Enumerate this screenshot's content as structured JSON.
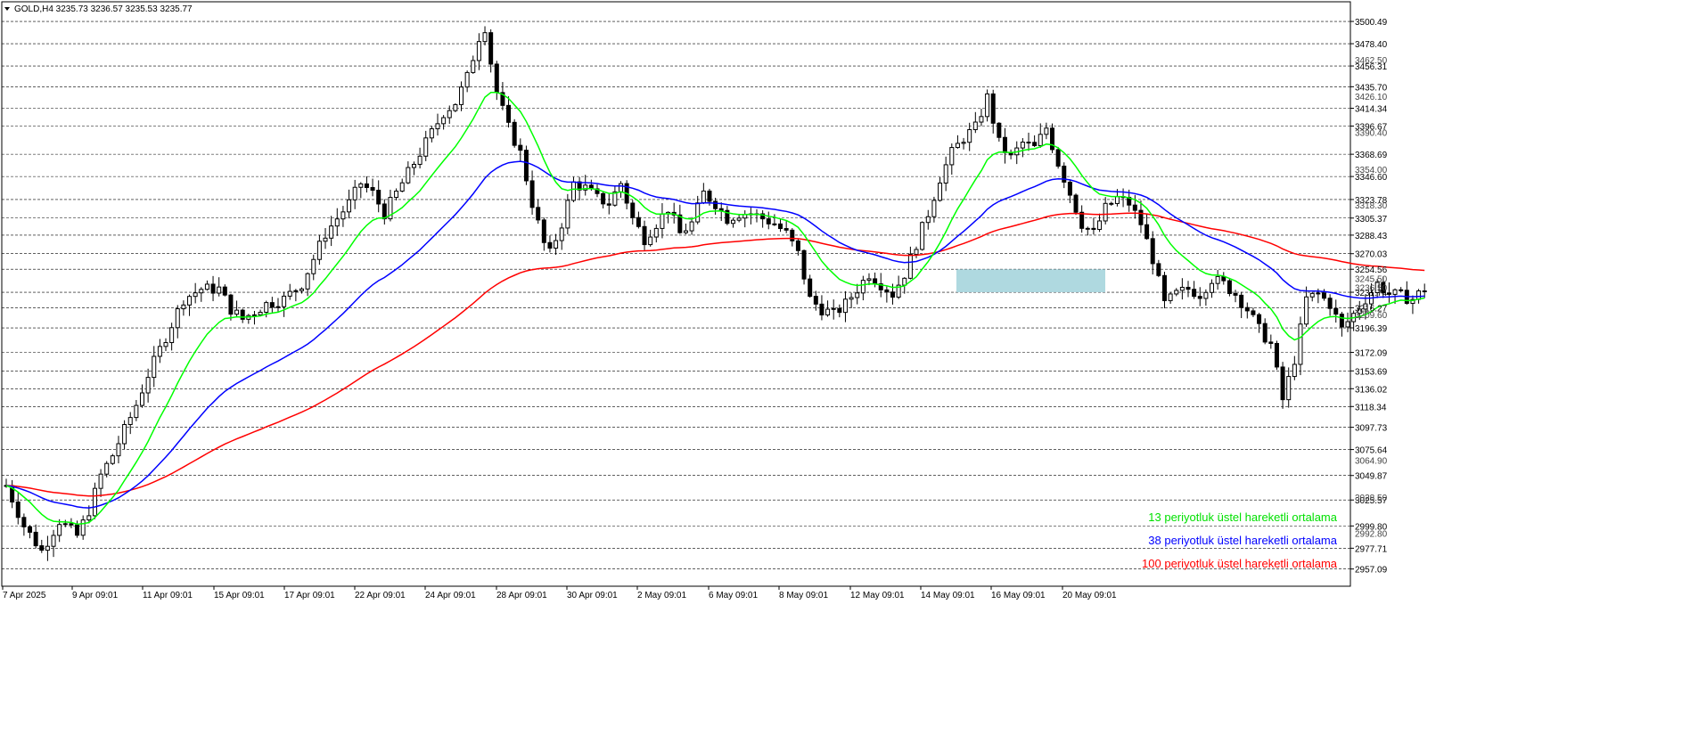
{
  "header": {
    "symbol_text": "GOLD,H4  3235.73 3236.57 3235.53 3235.77",
    "menu_icon": "triangle-down-icon"
  },
  "chart_data": {
    "type": "candlestick",
    "symbol": "GOLD",
    "timeframe": "H4",
    "last_ohlc": {
      "open": 3235.73,
      "high": 3236.57,
      "low": 3235.53,
      "close": 3235.77
    },
    "ylim": [
      2940,
      3520
    ],
    "y_levels": [
      3500.49,
      3478.4,
      3456.31,
      3435.7,
      3414.34,
      3396.67,
      3368.69,
      3346.6,
      3323.78,
      3305.37,
      3288.43,
      3270.03,
      3254.56,
      3231.74,
      3216.27,
      3196.39,
      3172.09,
      3153.69,
      3136.02,
      3118.34,
      3097.73,
      3075.64,
      3049.87,
      3025.57,
      2999.8,
      2977.71,
      2957.09
    ],
    "minor_levels": [
      3462.5,
      3426.1,
      3390.4,
      3354.0,
      3318.3,
      3245.5,
      3236.5,
      3209.6,
      3064.9,
      3028.5,
      2992.8
    ],
    "x_labels": [
      "7 Apr 2025",
      "9 Apr 09:01",
      "11 Apr 09:01",
      "15 Apr 09:01",
      "17 Apr 09:01",
      "22 Apr 09:01",
      "24 Apr 09:01",
      "28 Apr 09:01",
      "30 Apr 09:01",
      "2 May 09:01",
      "6 May 09:01",
      "8 May 09:01",
      "12 May 09:01",
      "14 May 09:01",
      "16 May 09:01",
      "20 May 09:01"
    ],
    "bars_per_label": 12,
    "anchors": [
      [
        0,
        3040
      ],
      [
        3,
        3000
      ],
      [
        6,
        2975
      ],
      [
        9,
        3005
      ],
      [
        12,
        2990
      ],
      [
        14,
        3015
      ],
      [
        16,
        3050
      ],
      [
        18,
        3070
      ],
      [
        20,
        3095
      ],
      [
        22,
        3120
      ],
      [
        24,
        3150
      ],
      [
        26,
        3175
      ],
      [
        28,
        3200
      ],
      [
        30,
        3225
      ],
      [
        33,
        3235
      ],
      [
        36,
        3235
      ],
      [
        38,
        3215
      ],
      [
        40,
        3205
      ],
      [
        44,
        3220
      ],
      [
        47,
        3225
      ],
      [
        50,
        3240
      ],
      [
        52,
        3265
      ],
      [
        54,
        3290
      ],
      [
        56,
        3305
      ],
      [
        58,
        3320
      ],
      [
        60,
        3340
      ],
      [
        62,
        3330
      ],
      [
        64,
        3310
      ],
      [
        66,
        3330
      ],
      [
        68,
        3350
      ],
      [
        70,
        3370
      ],
      [
        72,
        3390
      ],
      [
        74,
        3410
      ],
      [
        76,
        3420
      ],
      [
        78,
        3445
      ],
      [
        80,
        3485
      ],
      [
        81,
        3495
      ],
      [
        82,
        3460
      ],
      [
        83,
        3430
      ],
      [
        85,
        3395
      ],
      [
        87,
        3370
      ],
      [
        89,
        3320
      ],
      [
        91,
        3280
      ],
      [
        92,
        3270
      ],
      [
        94,
        3300
      ],
      [
        96,
        3340
      ],
      [
        98,
        3335
      ],
      [
        100,
        3325
      ],
      [
        102,
        3320
      ],
      [
        104,
        3340
      ],
      [
        106,
        3305
      ],
      [
        108,
        3285
      ],
      [
        110,
        3300
      ],
      [
        112,
        3315
      ],
      [
        114,
        3290
      ],
      [
        116,
        3300
      ],
      [
        118,
        3330
      ],
      [
        120,
        3320
      ],
      [
        122,
        3305
      ],
      [
        124,
        3310
      ],
      [
        126,
        3310
      ],
      [
        128,
        3305
      ],
      [
        130,
        3300
      ],
      [
        132,
        3290
      ],
      [
        134,
        3270
      ],
      [
        136,
        3225
      ],
      [
        138,
        3215
      ],
      [
        140,
        3210
      ],
      [
        142,
        3220
      ],
      [
        144,
        3235
      ],
      [
        146,
        3250
      ],
      [
        148,
        3240
      ],
      [
        150,
        3230
      ],
      [
        152,
        3250
      ],
      [
        154,
        3280
      ],
      [
        156,
        3310
      ],
      [
        158,
        3345
      ],
      [
        160,
        3370
      ],
      [
        162,
        3385
      ],
      [
        164,
        3395
      ],
      [
        166,
        3425
      ],
      [
        168,
        3380
      ],
      [
        170,
        3365
      ],
      [
        172,
        3380
      ],
      [
        174,
        3375
      ],
      [
        176,
        3395
      ],
      [
        178,
        3360
      ],
      [
        180,
        3330
      ],
      [
        182,
        3300
      ],
      [
        184,
        3290
      ],
      [
        186,
        3315
      ],
      [
        188,
        3325
      ],
      [
        190,
        3320
      ],
      [
        192,
        3300
      ],
      [
        194,
        3265
      ],
      [
        196,
        3220
      ],
      [
        198,
        3230
      ],
      [
        200,
        3235
      ],
      [
        202,
        3230
      ],
      [
        204,
        3245
      ],
      [
        206,
        3240
      ],
      [
        208,
        3230
      ],
      [
        210,
        3215
      ],
      [
        212,
        3195
      ],
      [
        214,
        3180
      ],
      [
        216,
        3125
      ],
      [
        218,
        3165
      ],
      [
        220,
        3225
      ],
      [
        222,
        3230
      ],
      [
        224,
        3220
      ],
      [
        226,
        3195
      ],
      [
        228,
        3210
      ],
      [
        230,
        3225
      ],
      [
        232,
        3240
      ],
      [
        234,
        3230
      ],
      [
        236,
        3228
      ],
      [
        238,
        3225
      ],
      [
        240,
        3235
      ]
    ],
    "ma_13": {
      "period": 13,
      "color": "#00ff00"
    },
    "ma_38": {
      "period": 38,
      "color": "#0000ff"
    },
    "ma_100": {
      "period": 100,
      "color": "#ff0000",
      "seed": 3040
    },
    "highlight_zone": {
      "x_from": 1073,
      "x_to": 1240,
      "y_top": 3254.56,
      "y_bottom": 3231.74,
      "color": "#a6d5dd"
    },
    "legend": [
      {
        "label": "13 periyotluk üstel hareketli ortalama",
        "color": "#00e000"
      },
      {
        "label": "38 periyotluk üstel hareketli ortalama",
        "color": "#0000ff"
      },
      {
        "label": "100 periyotluk üstel hareketli ortalama",
        "color": "#ff0000"
      }
    ]
  }
}
